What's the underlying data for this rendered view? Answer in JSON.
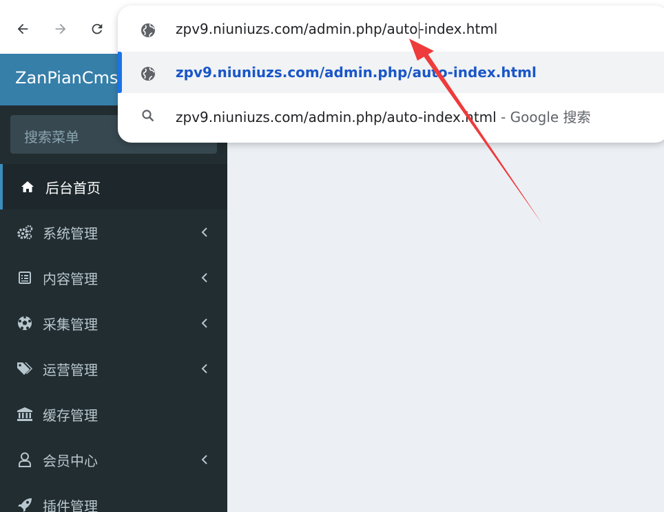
{
  "browser": {
    "back_icon": "arrow-left-icon",
    "forward_icon": "arrow-right-icon",
    "reload_icon": "reload-icon",
    "omnibox": {
      "input_before_caret": "zpv9.niuniuzs.com/admin.php/auto",
      "input_after_caret": "-index.html",
      "suggestion": "zpv9.niuniuzs.com/admin.php/auto-index.html",
      "search_query": "zpv9.niuniuzs.com/admin.php/auto-index.html",
      "search_suffix": "- Google 搜索"
    }
  },
  "admin": {
    "brand": "ZanPianCms",
    "search_placeholder": "搜索菜单",
    "menu": [
      {
        "label": "后台首页",
        "icon": "home-icon",
        "active": true,
        "has_children": false
      },
      {
        "label": "系统管理",
        "icon": "cogs-icon",
        "active": false,
        "has_children": true
      },
      {
        "label": "内容管理",
        "icon": "list-alt-icon",
        "active": false,
        "has_children": true
      },
      {
        "label": "采集管理",
        "icon": "soccer-ball-icon",
        "active": false,
        "has_children": true
      },
      {
        "label": "运营管理",
        "icon": "tags-icon",
        "active": false,
        "has_children": true
      },
      {
        "label": "缓存管理",
        "icon": "bank-icon",
        "active": false,
        "has_children": false
      },
      {
        "label": "会员中心",
        "icon": "user-icon",
        "active": false,
        "has_children": true
      },
      {
        "label": "插件管理",
        "icon": "rocket-icon",
        "active": false,
        "has_children": false
      }
    ]
  },
  "colors": {
    "brand_bar": "#367fa9",
    "sidebar": "#222d32",
    "active_item": "#1e282c",
    "active_border": "#3c8dbc",
    "content": "#ecf0f5",
    "suggestion_link": "#1a56c8",
    "annotation_arrow": "#ee3b3b"
  }
}
